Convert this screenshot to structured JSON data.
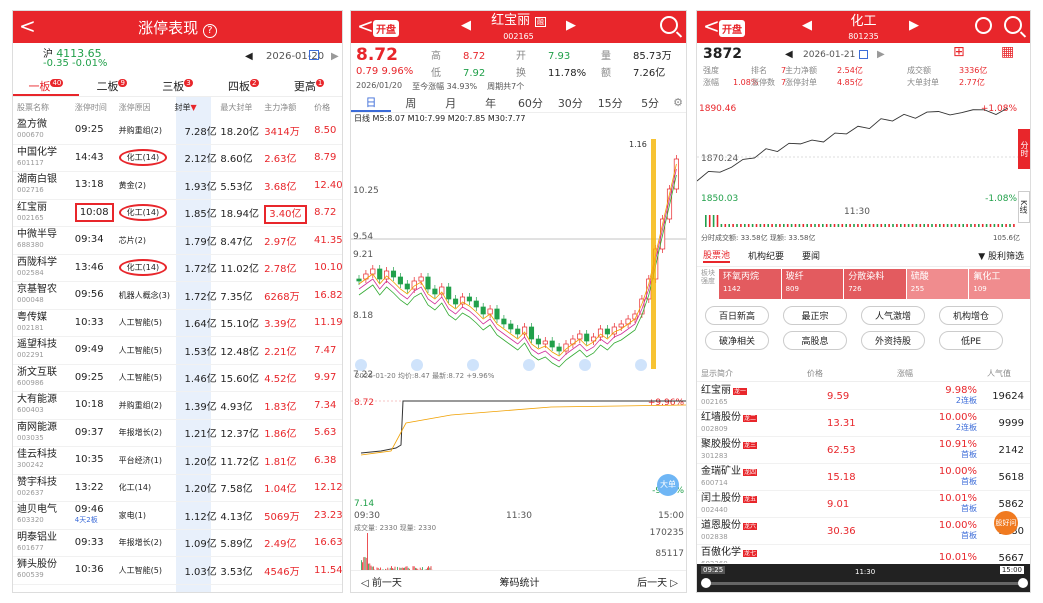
{
  "p1": {
    "title": "涨停表现",
    "back": "<",
    "help": "?",
    "index_name": "沪",
    "index_value": "4113.65",
    "index_change": "-0.35  -0.01%",
    "date": "2026-01-20",
    "tabs": [
      {
        "label": "一板",
        "badge": "40"
      },
      {
        "label": "二板",
        "badge": "9"
      },
      {
        "label": "三板",
        "badge": "3"
      },
      {
        "label": "四板",
        "badge": "2"
      },
      {
        "label": "更高",
        "badge": "1"
      }
    ],
    "cols": [
      "股票名称",
      "涨停时间",
      "涨停原因",
      "封单",
      "最大封单",
      "主力净额",
      "价格"
    ],
    "rows": [
      {
        "name": "盈方微",
        "code": "000670",
        "time": "09:25",
        "reason": "并购重组(2)",
        "seal": "7.28亿",
        "max": "18.20亿",
        "net": "3414万",
        "price": "8.50"
      },
      {
        "name": "中国化学",
        "code": "601117",
        "time": "14:43",
        "reason": "化工(14)",
        "seal": "2.12亿",
        "max": "8.60亿",
        "net": "2.63亿",
        "price": "8.79"
      },
      {
        "name": "湖南白银",
        "code": "002716",
        "time": "13:18",
        "reason": "黄金(2)",
        "seal": "1.93亿",
        "max": "5.53亿",
        "net": "3.68亿",
        "price": "12.40"
      },
      {
        "name": "红宝丽",
        "code": "002165",
        "time": "10:08",
        "reason": "化工(14)",
        "seal": "1.85亿",
        "max": "18.94亿",
        "net": "3.40亿",
        "price": "8.72"
      },
      {
        "name": "中微半导",
        "code": "688380",
        "time": "09:34",
        "reason": "芯片(2)",
        "seal": "1.79亿",
        "max": "8.47亿",
        "net": "2.97亿",
        "price": "41.35"
      },
      {
        "name": "西陇科学",
        "code": "002584",
        "time": "13:46",
        "reason": "化工(14)",
        "seal": "1.72亿",
        "max": "11.02亿",
        "net": "2.78亿",
        "price": "10.10"
      },
      {
        "name": "京基智农",
        "code": "000048",
        "time": "09:56",
        "reason": "机器人概念(3)",
        "seal": "1.72亿",
        "max": "7.35亿",
        "net": "6268万",
        "price": "16.82"
      },
      {
        "name": "粤传媒",
        "code": "002181",
        "time": "10:33",
        "reason": "人工智能(5)",
        "seal": "1.64亿",
        "max": "15.10亿",
        "net": "3.39亿",
        "price": "11.19"
      },
      {
        "name": "遥望科技",
        "code": "002291",
        "time": "09:49",
        "reason": "人工智能(5)",
        "seal": "1.53亿",
        "max": "12.48亿",
        "net": "2.21亿",
        "price": "7.47"
      },
      {
        "name": "浙文互联",
        "code": "600986",
        "time": "09:25",
        "reason": "人工智能(5)",
        "seal": "1.46亿",
        "max": "15.60亿",
        "net": "4.52亿",
        "price": "9.97"
      },
      {
        "name": "大有能源",
        "code": "600403",
        "time": "10:18",
        "reason": "并购重组(2)",
        "seal": "1.39亿",
        "max": "4.93亿",
        "net": "1.83亿",
        "price": "7.34"
      },
      {
        "name": "南网能源",
        "code": "003035",
        "time": "09:37",
        "reason": "年报增长(2)",
        "seal": "1.21亿",
        "max": "12.37亿",
        "net": "1.86亿",
        "price": "5.63"
      },
      {
        "name": "佳云科技",
        "code": "300242",
        "time": "10:35",
        "reason": "平台经济(1)",
        "seal": "1.20亿",
        "max": "11.72亿",
        "net": "1.81亿",
        "price": "6.38"
      },
      {
        "name": "赞宇科技",
        "code": "002637",
        "time": "13:22",
        "reason": "化工(14)",
        "seal": "1.20亿",
        "max": "7.58亿",
        "net": "1.04亿",
        "price": "12.12"
      },
      {
        "name": "迪贝电气",
        "code": "603320",
        "time": "09:46",
        "time2": "4天2板",
        "reason": "家电(1)",
        "seal": "1.12亿",
        "max": "4.13亿",
        "net": "5069万",
        "price": "23.23"
      },
      {
        "name": "明泰铝业",
        "code": "601677",
        "time": "09:33",
        "reason": "年报增长(2)",
        "seal": "1.09亿",
        "max": "5.89亿",
        "net": "2.49亿",
        "price": "16.63"
      },
      {
        "name": "狮头股份",
        "code": "600539",
        "time": "10:36",
        "reason": "人工智能(5)",
        "seal": "1.03亿",
        "max": "3.53亿",
        "net": "4546万",
        "price": "11.54"
      }
    ]
  },
  "p2": {
    "tag": "开盘",
    "name": "红宝丽",
    "name_badge": "融",
    "code": "002165",
    "price": "8.72",
    "change": "0.79  9.96%",
    "q": [
      {
        "l": "高",
        "v": "8.72"
      },
      {
        "l": "开",
        "v": "7.93"
      },
      {
        "l": "量",
        "v": "85.73万"
      },
      {
        "l": "低",
        "v": "7.92"
      },
      {
        "l": "换",
        "v": "11.78%"
      },
      {
        "l": "额",
        "v": "7.26亿"
      }
    ],
    "date": "2026/01/20",
    "info1": "至今涨幅 34.93%",
    "info2": "周期共7个",
    "tabs": [
      "日",
      "周",
      "月",
      "年",
      "60分",
      "30分",
      "15分",
      "5分"
    ],
    "ma": "日线 M5:8.07  M10:7.99  M20:7.85  M30:7.77",
    "ylabels": [
      "10.25",
      "9.54",
      "9.21",
      "8.18",
      "7.22"
    ],
    "hi_label": "1.16",
    "tline_head": "2026-01-20  均价:8.47  最新:8.72 +9.96%",
    "t_hi": "8.72",
    "t_hi_pct": "+9.96%",
    "t_lo": "7.14",
    "t_lo_pct": "-9.96%",
    "t_times": [
      "09:30",
      "11:30",
      "15:00"
    ],
    "vol_head": "成交量: 2330  现量: 2330",
    "v1": "170235",
    "v2": "85117",
    "bottom": [
      "前一天",
      "筹码统计",
      "后一天"
    ],
    "fab": "大单"
  },
  "p3": {
    "tag": "开盘",
    "name": "化工",
    "code": "801235",
    "price": "3872",
    "date": "2026-01-21",
    "stats": [
      {
        "l": "强度",
        "v": ""
      },
      {
        "l": "排名",
        "v": "7"
      },
      {
        "l": "主力净额",
        "v": "2.54亿"
      },
      {
        "l": "成交额",
        "v": "3336亿"
      },
      {
        "l": "涨幅",
        "v": "1.08%"
      },
      {
        "l": "涨停数",
        "v": "7"
      },
      {
        "l": "涨停封单",
        "v": "4.85亿"
      },
      {
        "l": "大单封单",
        "v": "2.77亿"
      }
    ],
    "y_top": "1890.46",
    "y_mid": "1870.24",
    "y_bot": "1850.03",
    "pct_top": "+1.08%",
    "pct_bot": "-1.08%",
    "t_mid": "11:30",
    "vol_line": "分时成交额: 33.58亿  现额: 33.58亿",
    "vol_max": "105.6亿",
    "side1": "分时",
    "side2": "K线",
    "subtabs": [
      "股票池",
      "机构纪要",
      "要闻"
    ],
    "filter": "股利筛选",
    "strip": [
      {
        "l": "环氧丙烷",
        "v": "1142"
      },
      {
        "l": "玻纤",
        "v": "809"
      },
      {
        "l": "分散染料",
        "v": "726"
      },
      {
        "l": "硫酸",
        "v": "255"
      },
      {
        "l": "氟化工",
        "v": "109"
      }
    ],
    "strip_label": "板块强度",
    "chips": [
      "百日新高",
      "最正宗",
      "人气激增",
      "机构增仓",
      "破净相关",
      "高股息",
      "外资持股",
      "低PE"
    ],
    "lcols": [
      "显示简介",
      "价格",
      "涨幅",
      "人气值"
    ],
    "list": [
      {
        "n": "红宝丽",
        "c": "002165",
        "t": "龙一",
        "p": "9.59",
        "pct": "9.98%",
        "b": "2连板",
        "h": "19624"
      },
      {
        "n": "红墙股份",
        "c": "002809",
        "t": "龙二",
        "p": "13.31",
        "pct": "10.00%",
        "b": "2连板",
        "h": "9999"
      },
      {
        "n": "聚胶股份",
        "c": "301283",
        "t": "龙三",
        "p": "62.53",
        "pct": "10.91%",
        "b": "首板",
        "h": "2142"
      },
      {
        "n": "金瑞矿业",
        "c": "600714",
        "t": "龙四",
        "p": "15.18",
        "pct": "10.00%",
        "b": "首板",
        "h": "5618"
      },
      {
        "n": "闰土股份",
        "c": "002440",
        "t": "龙五",
        "p": "9.01",
        "pct": "10.01%",
        "b": "首板",
        "h": "5862"
      },
      {
        "n": "道恩股份",
        "c": "002838",
        "t": "龙六",
        "p": "30.36",
        "pct": "10.00%",
        "b": "首板",
        "h": "3080"
      },
      {
        "n": "百傲化学",
        "c": "603360",
        "t": "龙七",
        "p": "",
        "pct": "10.01%",
        "b": "",
        "h": "5667"
      }
    ],
    "timeline": [
      "09:25",
      "11:30",
      "15:00"
    ],
    "fab": "股好问"
  },
  "colors": {
    "red": "#e8262b",
    "green": "#21a04a"
  }
}
